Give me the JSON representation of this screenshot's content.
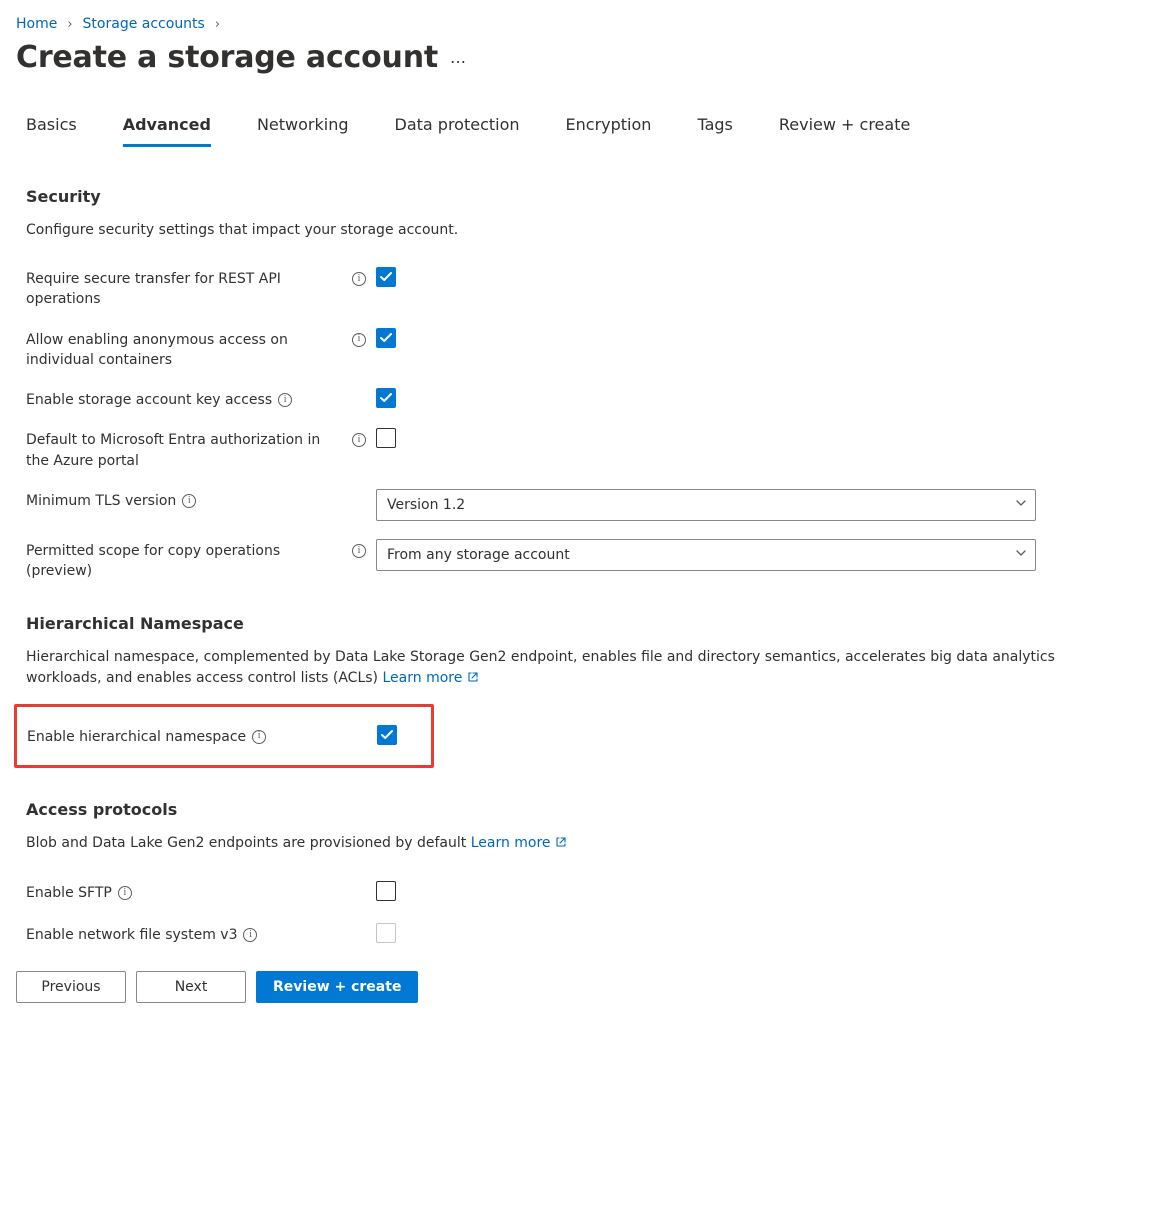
{
  "breadcrumb": {
    "home": "Home",
    "storage_accounts": "Storage accounts"
  },
  "page_title": "Create a storage account",
  "tabs": {
    "basics": "Basics",
    "advanced": "Advanced",
    "networking": "Networking",
    "data_protection": "Data protection",
    "encryption": "Encryption",
    "tags": "Tags",
    "review_create": "Review + create",
    "active": "advanced"
  },
  "security": {
    "heading": "Security",
    "desc": "Configure security settings that impact your storage account.",
    "require_secure_transfer": {
      "label": "Require secure transfer for REST API operations",
      "checked": true
    },
    "allow_anonymous": {
      "label": "Allow enabling anonymous access on individual containers",
      "checked": true
    },
    "enable_key_access": {
      "label": "Enable storage account key access",
      "checked": true
    },
    "entra_default": {
      "label": "Default to Microsoft Entra authorization in the Azure portal",
      "checked": false
    },
    "min_tls": {
      "label": "Minimum TLS version",
      "value": "Version 1.2"
    },
    "copy_scope": {
      "label": "Permitted scope for copy operations (preview)",
      "value": "From any storage account"
    }
  },
  "hns": {
    "heading": "Hierarchical Namespace",
    "desc": "Hierarchical namespace, complemented by Data Lake Storage Gen2 endpoint, enables file and directory semantics, accelerates big data analytics workloads, and enables access control lists (ACLs)",
    "learn_more": "Learn more",
    "enable": {
      "label": "Enable hierarchical namespace",
      "checked": true
    }
  },
  "access_protocols": {
    "heading": "Access protocols",
    "desc": "Blob and Data Lake Gen2 endpoints are provisioned by default",
    "learn_more": "Learn more",
    "enable_sftp": {
      "label": "Enable SFTP",
      "checked": false
    },
    "enable_nfs": {
      "label": "Enable network file system v3",
      "checked": false,
      "disabled": true
    }
  },
  "footer": {
    "previous": "Previous",
    "next": "Next",
    "review_create": "Review + create"
  }
}
